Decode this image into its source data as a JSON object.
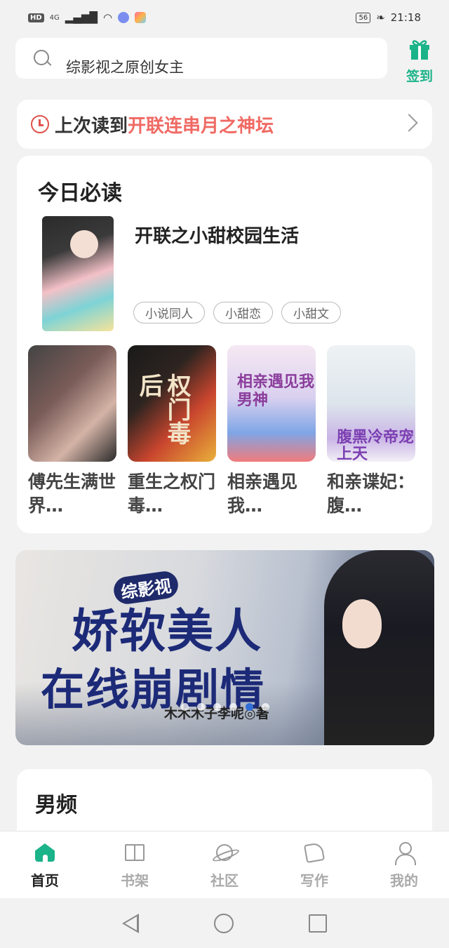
{
  "status_bar": {
    "hd": "HD",
    "network": "4G",
    "battery": "56",
    "time": "21:18"
  },
  "search": {
    "hint_text": "综影视之原创女主",
    "icon": "search-icon"
  },
  "signin": {
    "label": "签到",
    "icon": "gift-icon",
    "color": "#1bb389"
  },
  "continue_reading": {
    "prefix": "上次读到",
    "book_title": "开联连串月之神坛",
    "icon": "clock-icon",
    "accent": "#f06a64"
  },
  "daily": {
    "title": "今日必读",
    "featured": {
      "title": "开联之小甜校园生活",
      "tags": [
        "小说同人",
        "小甜恋",
        "小甜文"
      ]
    },
    "books": [
      {
        "title": "傅先生满世界…",
        "cover_text": ""
      },
      {
        "title": "重生之权门毒…",
        "cover_text": "权门毒后"
      },
      {
        "title": "相亲遇见我…",
        "cover_text": "相亲遇见我男神"
      },
      {
        "title": "和亲谍妃：腹…",
        "cover_text": "腹黑冷帝宠上天"
      }
    ]
  },
  "banner": {
    "series": "综影视",
    "line1": "娇软美人",
    "line2": "在线崩剧情",
    "author": "木木木子李呢◎著",
    "slide_count": 6,
    "active_slide": 5
  },
  "male_section": {
    "title": "男频"
  },
  "tab_bar": {
    "tabs": [
      {
        "label": "首页",
        "icon": "home-icon",
        "active": true
      },
      {
        "label": "书架",
        "icon": "bookshelf-icon",
        "active": false
      },
      {
        "label": "社区",
        "icon": "planet-icon",
        "active": false
      },
      {
        "label": "写作",
        "icon": "pen-icon",
        "active": false
      },
      {
        "label": "我的",
        "icon": "user-icon",
        "active": false
      }
    ]
  }
}
